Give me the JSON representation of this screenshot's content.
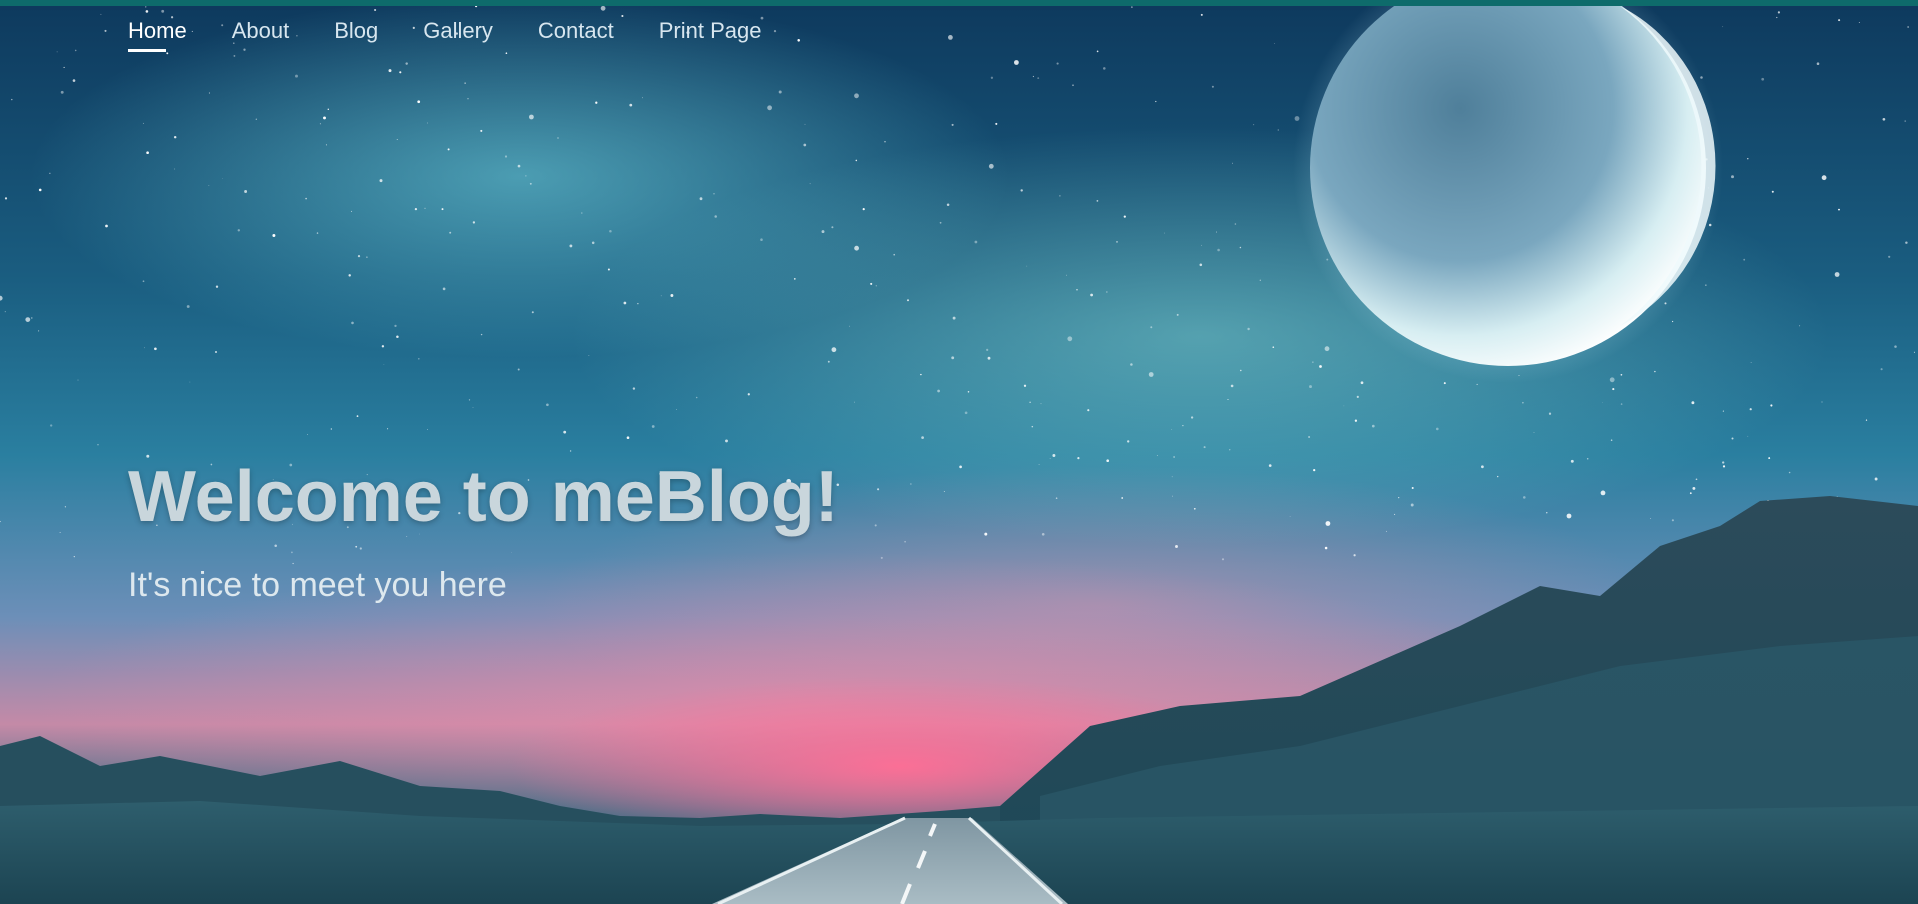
{
  "nav": {
    "items": [
      {
        "label": "Home",
        "active": true
      },
      {
        "label": "About",
        "active": false
      },
      {
        "label": "Blog",
        "active": false
      },
      {
        "label": "Gallery",
        "active": false
      },
      {
        "label": "Contact",
        "active": false
      },
      {
        "label": "Print Page",
        "active": false
      }
    ]
  },
  "hero": {
    "title": "Welcome to meBlog!",
    "subtitle": "It's nice to meet you here"
  },
  "colors": {
    "topbar": "#0e6b6b",
    "nav_text": "#d7e6ef",
    "title": "#c9d6dc"
  },
  "icons": [
    "moon-graphic",
    "road-graphic",
    "mountain-graphic"
  ]
}
